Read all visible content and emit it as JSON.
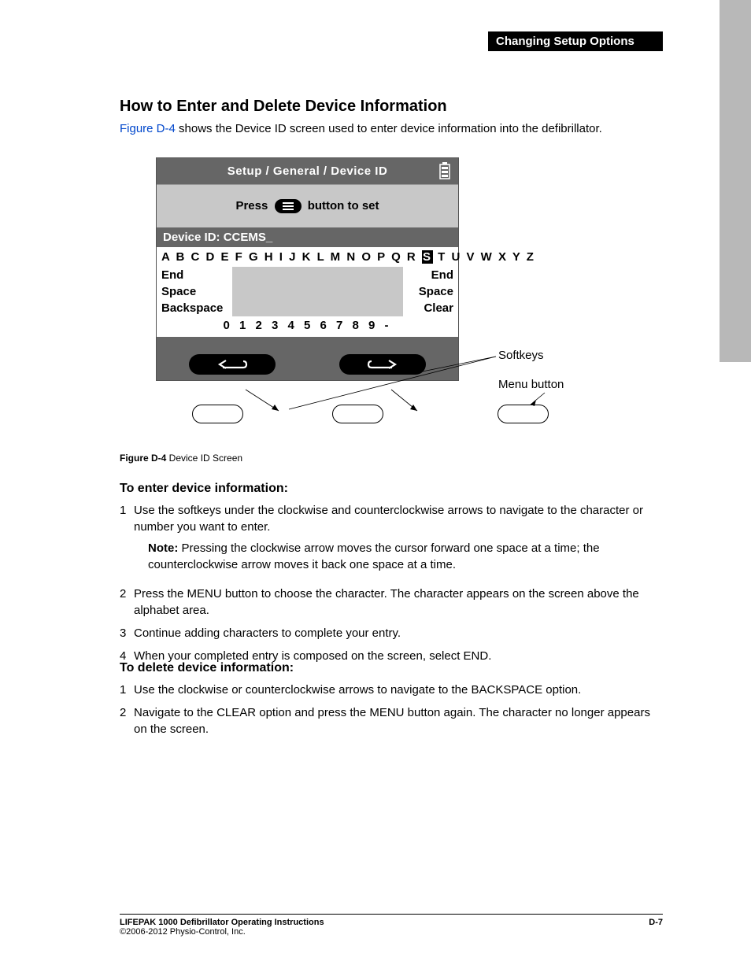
{
  "header": {
    "section_banner": "Changing Setup Options"
  },
  "headings": {
    "main": "How to Enter and Delete Device Information"
  },
  "intro": {
    "figref": "Figure D-4",
    "rest": " shows the Device ID screen used to enter device information into the defibrillator."
  },
  "device": {
    "title": "Setup / General / Device ID",
    "press_left": "Press ",
    "press_right": " button to set",
    "id_label": "Device ID: CCEMS_",
    "alpha_left": "A B C D E F G H I J K L M N O P Q R",
    "alpha_sel": "S",
    "alpha_right": "T U V W X Y Z",
    "row1": {
      "l": "End",
      "r": "End"
    },
    "row2": {
      "l": "Space",
      "r": "Space"
    },
    "row3": {
      "l": "Backspace",
      "r": "Clear"
    },
    "digits": "0 1 2 3 4 5 6 7 8 9 -"
  },
  "labels": {
    "softkeys": "Softkeys",
    "menu_button": "Menu button"
  },
  "figure": {
    "caption_bold": "Figure D-4",
    "caption_rest": "  Device ID Screen"
  },
  "enter": {
    "heading": "To enter device information:",
    "steps": [
      "Use the softkeys under the clockwise and counterclockwise arrows to navigate to the character or number you want to enter.",
      "Press the MENU button to choose the character. The character appears on the screen above the alphabet area.",
      "Continue adding characters to complete your entry.",
      "When your completed entry is composed on the screen, select END."
    ],
    "note_label": "Note:",
    "note_text": "  Pressing the clockwise arrow moves the cursor forward one space at a time; the counterclockwise arrow moves it back one space at a time."
  },
  "del": {
    "heading": "To delete device information:",
    "steps": [
      "Use the clockwise or counterclockwise arrows to navigate to the BACKSPACE option.",
      "Navigate to the CLEAR option and press the MENU button again. The character no longer appears on the screen."
    ]
  },
  "footer": {
    "title": "LIFEPAK 1000 Defibrillator Operating Instructions",
    "copyright": "©2006-2012 Physio-Control, Inc.",
    "pageno": "D-7"
  }
}
